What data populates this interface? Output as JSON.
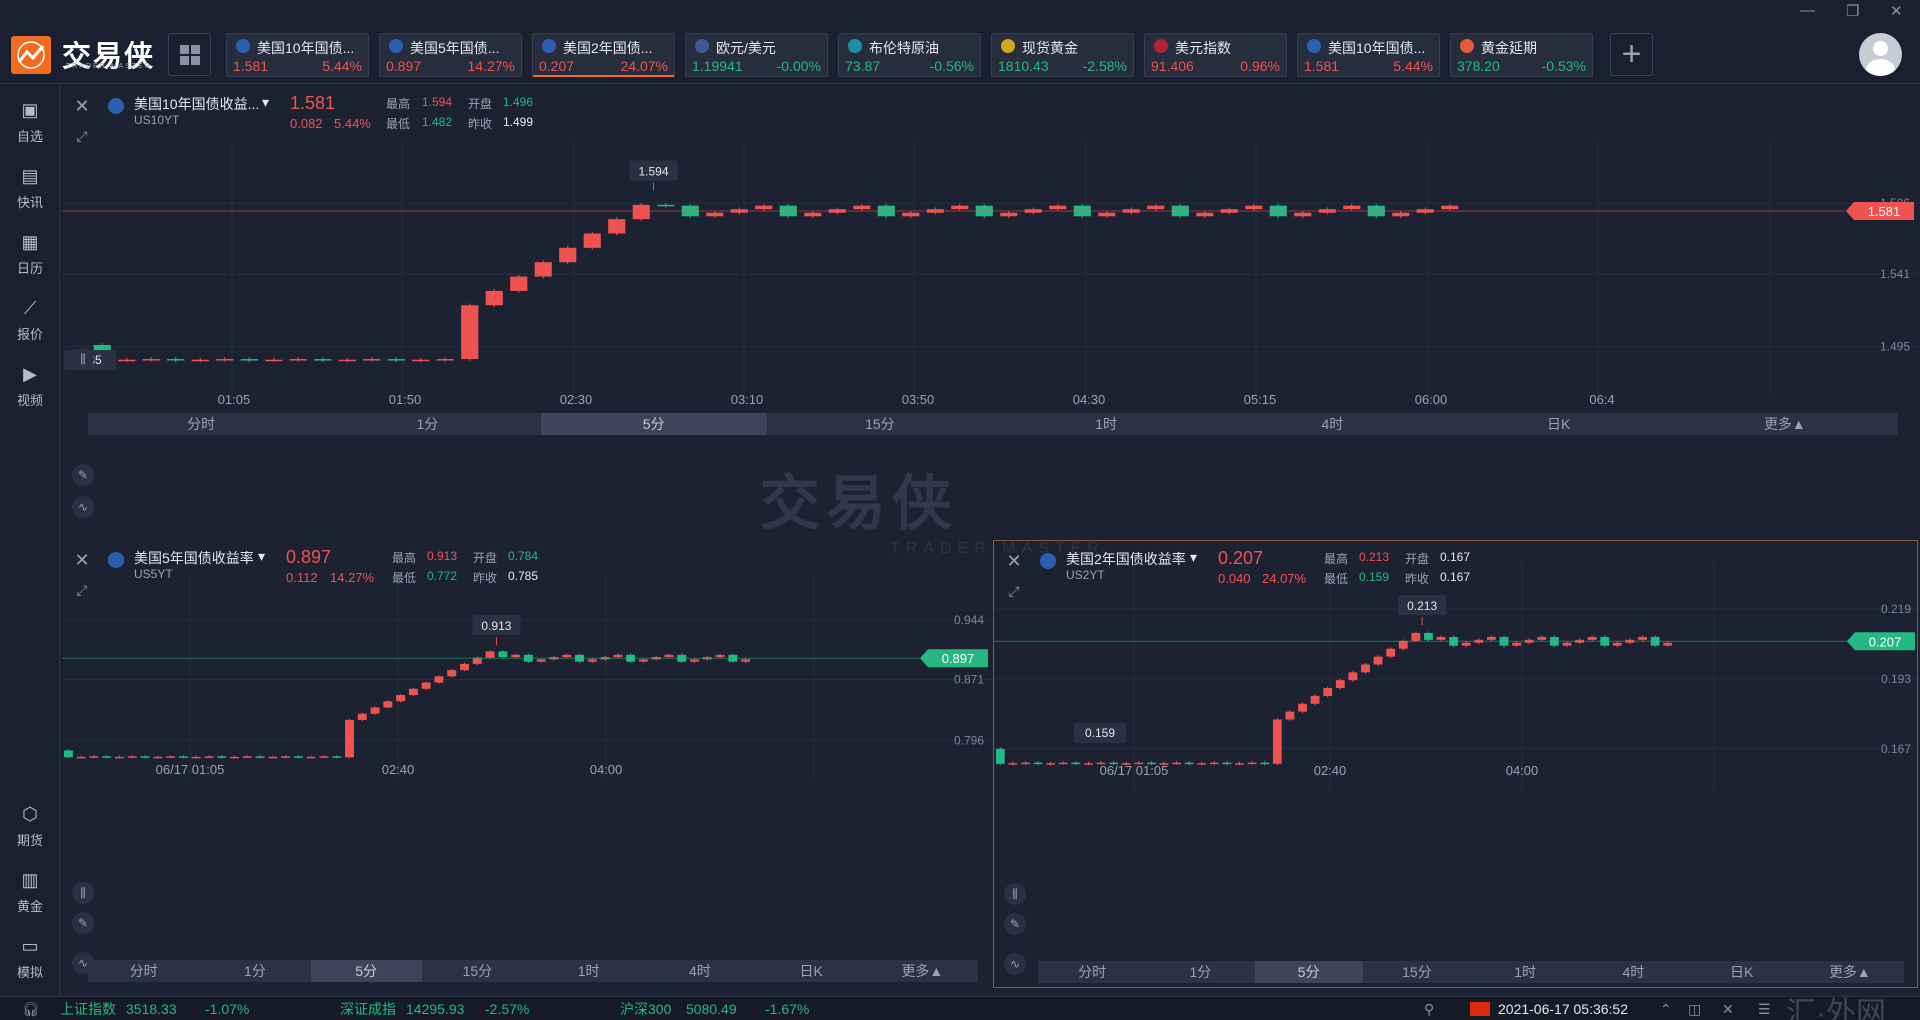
{
  "app": {
    "logo_text": "交易侠",
    "logo_sub": "TRADER MASTER",
    "watermark": "交易侠",
    "watermark_sub": "TRADER MASTER",
    "corner_mark": "汇·外网"
  },
  "top_quotes": [
    {
      "name": "美国10年国债...",
      "price": "1.581",
      "pct": "5.44%",
      "dir": "up",
      "icon": "bar-chart-icon"
    },
    {
      "name": "美国5年国债...",
      "price": "0.897",
      "pct": "14.27%",
      "dir": "up",
      "icon": "bar-chart-icon"
    },
    {
      "name": "美国2年国债...",
      "price": "0.207",
      "pct": "24.07%",
      "dir": "up",
      "icon": "bar-chart-icon"
    },
    {
      "name": "欧元/美元",
      "price": "1.19941",
      "pct": "-0.00%",
      "dir": "down",
      "icon": "eu-us-flag-icon"
    },
    {
      "name": "布伦特原油",
      "price": "73.87",
      "pct": "-0.56%",
      "dir": "down",
      "icon": "oil-icon"
    },
    {
      "name": "现货黄金",
      "price": "1810.43",
      "pct": "-2.58%",
      "dir": "down",
      "icon": "gold-icon"
    },
    {
      "name": "美元指数",
      "price": "91.406",
      "pct": "0.96%",
      "dir": "up",
      "icon": "us-flag-icon"
    },
    {
      "name": "美国10年国债...",
      "price": "1.581",
      "pct": "5.44%",
      "dir": "up",
      "icon": "bar-chart-icon"
    },
    {
      "name": "黄金延期",
      "price": "378.20",
      "pct": "-0.53%",
      "dir": "down",
      "icon": "gold-bar-icon"
    }
  ],
  "nav": [
    {
      "label": "自选",
      "icon": "bookmark-icon"
    },
    {
      "label": "快讯",
      "icon": "news-icon"
    },
    {
      "label": "日历",
      "icon": "calendar-icon"
    },
    {
      "label": "报价",
      "icon": "line-chart-icon"
    },
    {
      "label": "视频",
      "icon": "video-icon"
    },
    {
      "label": "期货",
      "icon": "futures-icon"
    },
    {
      "label": "黄金",
      "icon": "gold-icon"
    },
    {
      "label": "模拟",
      "icon": "wallet-icon"
    }
  ],
  "panels": {
    "top": {
      "title": "美国10年国债收益...",
      "symbol": "US10YT",
      "last": "1.581",
      "change": "0.082",
      "pct": "5.44%",
      "high_label": "最高",
      "high": "1.594",
      "open_label": "开盘",
      "open": "1.496",
      "low_label": "最低",
      "low": "1.482",
      "prev_label": "昨收",
      "prev": "1.499",
      "hi_callout": "1.594",
      "lo_callout": ".485",
      "price_tag": "1.581",
      "periods": [
        "分时",
        "1分",
        "5分",
        "15分",
        "1时",
        "4时",
        "日K",
        "更多▲"
      ],
      "active_period": "5分"
    },
    "bl": {
      "title": "美国5年国债收益率",
      "symbol": "US5YT",
      "last": "0.897",
      "change": "0.112",
      "pct": "14.27%",
      "high_label": "最高",
      "high": "0.913",
      "open_label": "开盘",
      "open": "0.784",
      "low_label": "最低",
      "low": "0.772",
      "prev_label": "昨收",
      "prev": "0.785",
      "hi_callout": "0.913",
      "price_tag": "0.897",
      "periods": [
        "分时",
        "1分",
        "5分",
        "15分",
        "1时",
        "4时",
        "日K",
        "更多▲"
      ],
      "active_period": "5分"
    },
    "br": {
      "title": "美国2年国债收益率",
      "symbol": "US2YT",
      "last": "0.207",
      "change": "0.040",
      "pct": "24.07%",
      "high_label": "最高",
      "high": "0.213",
      "open_label": "开盘",
      "open": "0.167",
      "low_label": "最低",
      "low": "0.159",
      "prev_label": "昨收",
      "prev": "0.167",
      "hi_callout": "0.213",
      "lo_callout": "0.159",
      "price_tag": "0.207",
      "periods": [
        "分时",
        "1分",
        "5分",
        "15分",
        "1时",
        "4时",
        "日K",
        "更多▲"
      ],
      "active_period": "5分"
    }
  },
  "chart_data": [
    {
      "type": "candlestick",
      "title": "美国10年国债收益...",
      "x_ticks": [
        "01:05",
        "01:50",
        "02:30",
        "03:10",
        "03:50",
        "04:30",
        "05:15",
        "06:00",
        "06:4"
      ],
      "y_ticks": [
        "1.586",
        "1.541",
        "1.495"
      ],
      "last_price": 1.581,
      "high": 1.594,
      "low": 1.482,
      "ylim": [
        1.47,
        1.6
      ]
    },
    {
      "type": "candlestick",
      "title": "美国5年国债收益率",
      "x_ticks": [
        "06/17 01:05",
        "02:40",
        "04:00"
      ],
      "y_ticks": [
        "0.944",
        "0.871",
        "0.796"
      ],
      "last_price": 0.897,
      "high": 0.913,
      "low": 0.772,
      "ylim": [
        0.76,
        0.95
      ]
    },
    {
      "type": "candlestick",
      "title": "美国2年国债收益率",
      "x_ticks": [
        "06/17 01:05",
        "02:40",
        "04:00"
      ],
      "y_ticks": [
        "0.219",
        "0.193",
        "0.167"
      ],
      "last_price": 0.207,
      "high": 0.213,
      "low": 0.159,
      "ylim": [
        0.155,
        0.222
      ]
    }
  ],
  "status": {
    "items": [
      {
        "name": "上证指数",
        "value": "3518.33",
        "pct": "-1.07%"
      },
      {
        "name": "深证成指",
        "value": "14295.93",
        "pct": "-2.57%"
      },
      {
        "name": "沪深300",
        "value": "5080.49",
        "pct": "-1.67%"
      }
    ],
    "datetime": "2021-06-17 05:36:52"
  }
}
